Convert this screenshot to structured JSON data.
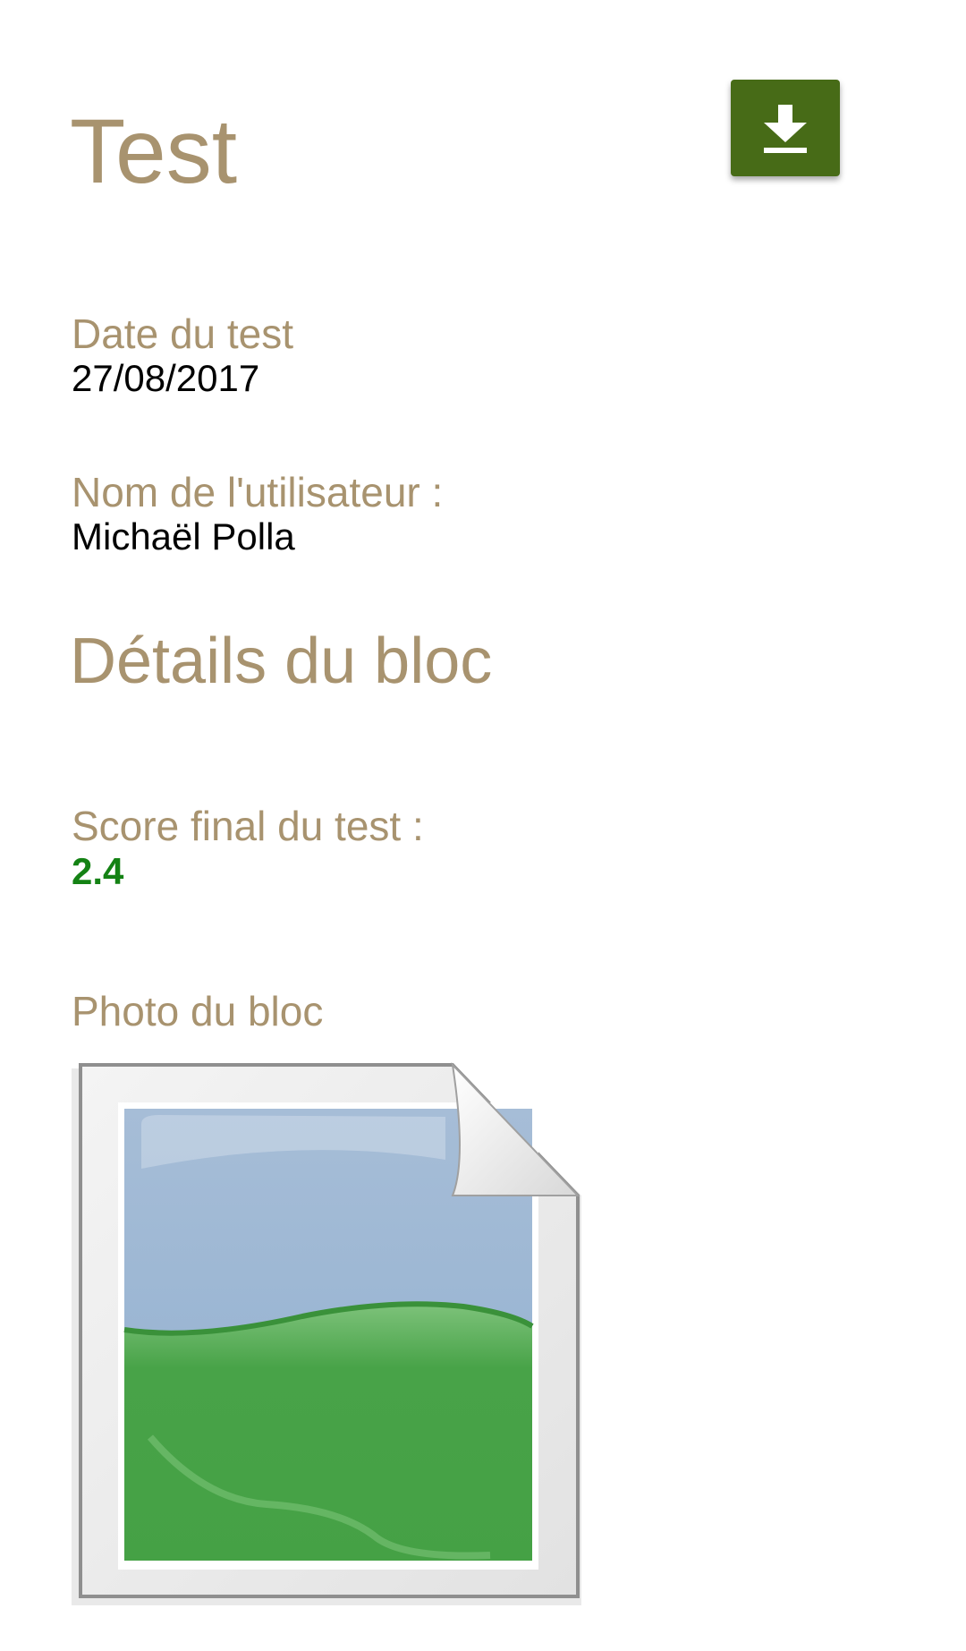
{
  "header": {
    "title": "Test"
  },
  "fields": {
    "date_label": "Date du test",
    "date_value": "27/08/2017",
    "user_label": "Nom de l'utilisateur :",
    "user_value": "Michaël Polla"
  },
  "section": {
    "title": "Détails du bloc"
  },
  "score": {
    "label": "Score final du test :",
    "value": "2.4"
  },
  "photo": {
    "label": "Photo du bloc",
    "icon": "image-placeholder-icon"
  },
  "actions": {
    "download_icon": "download-icon"
  },
  "colors": {
    "label": "#a8936f",
    "button": "#476b17",
    "score": "#148214"
  }
}
